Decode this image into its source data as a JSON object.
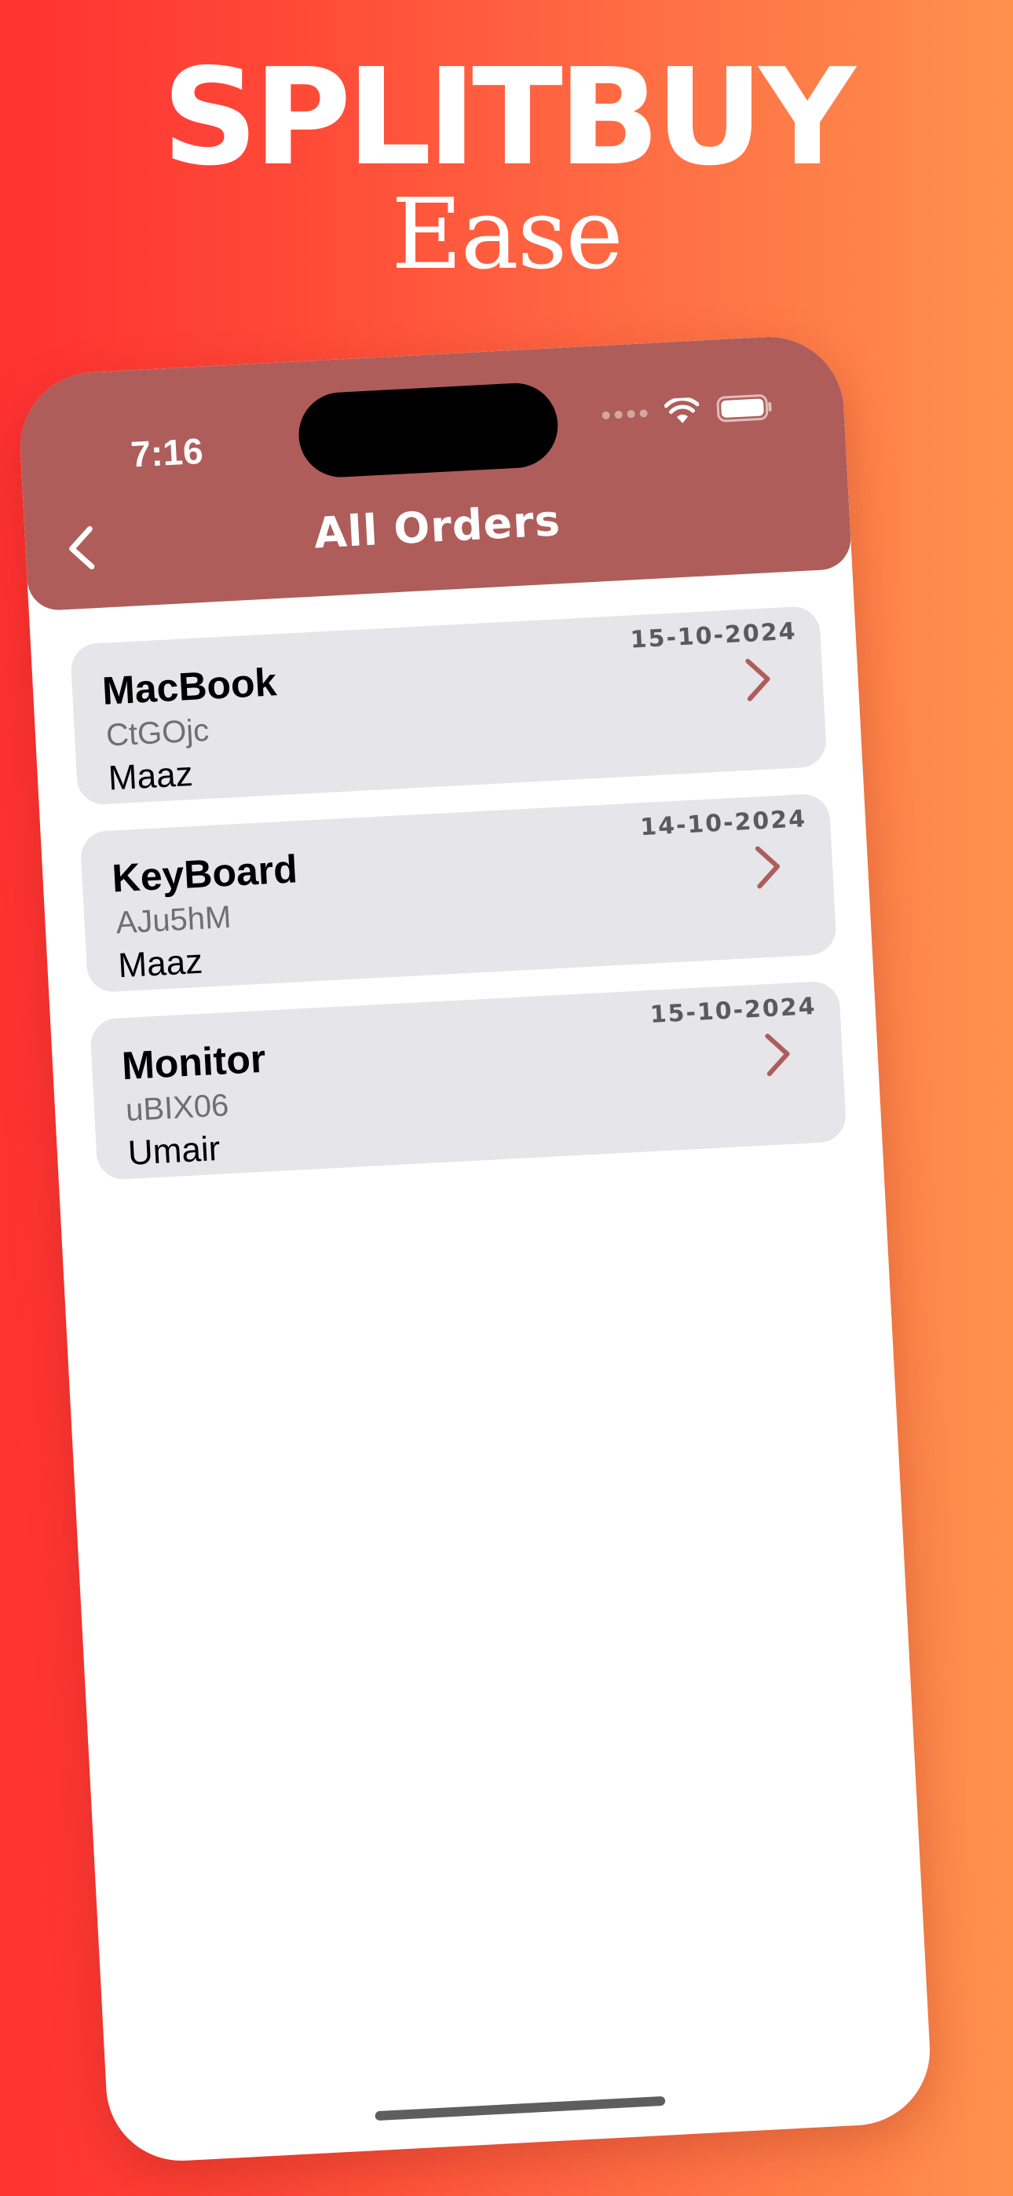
{
  "promo": {
    "title": "SPLITBUY",
    "subtitle": "Ease"
  },
  "status_bar": {
    "time": "7:16"
  },
  "header": {
    "title": "All Orders",
    "back_icon": "chevron-left-icon"
  },
  "colors": {
    "accent": "#af5d5a",
    "card_background": "#e5e5ea",
    "background_gradient_start": "#ff3131",
    "background_gradient_end": "#ff914d"
  },
  "orders": [
    {
      "name": "MacBook",
      "code": "CtGOjc",
      "user": "Maaz",
      "date": "15-10-2024"
    },
    {
      "name": "KeyBoard",
      "code": "AJu5hM",
      "user": "Maaz",
      "date": "14-10-2024"
    },
    {
      "name": "Monitor",
      "code": "uBIX06",
      "user": "Umair",
      "date": "15-10-2024"
    }
  ]
}
